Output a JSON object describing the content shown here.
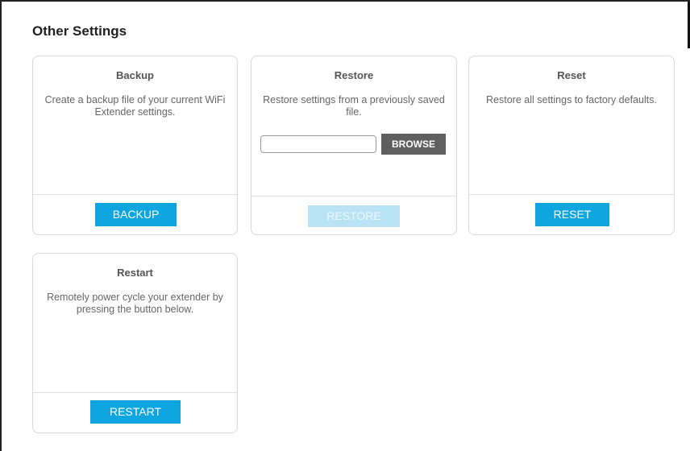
{
  "section": {
    "title": "Other Settings"
  },
  "cards": {
    "backup": {
      "title": "Backup",
      "description": "Create a backup file of your current WiFi Extender settings.",
      "button_label": "BACKUP"
    },
    "restore": {
      "title": "Restore",
      "description": "Restore settings from a previously saved file.",
      "file_value": "",
      "browse_label": "BROWSE",
      "button_label": "RESTORE",
      "button_disabled": true
    },
    "reset": {
      "title": "Reset",
      "description": "Restore all settings to factory defaults.",
      "button_label": "RESET"
    },
    "restart": {
      "title": "Restart",
      "description": "Remotely power cycle your extender by pressing the button below.",
      "button_label": "RESTART"
    }
  },
  "colors": {
    "primary_button": "#0ea5e0",
    "disabled_button": "#b9e3f4",
    "browse_button": "#5f5f5f",
    "card_border": "#d9d9d9"
  }
}
